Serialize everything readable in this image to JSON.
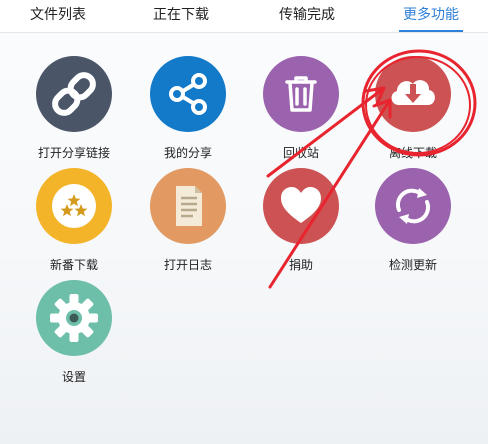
{
  "tabs": [
    {
      "label": "文件列表"
    },
    {
      "label": "正在下载"
    },
    {
      "label": "传输完成"
    },
    {
      "label": "更多功能"
    }
  ],
  "features": [
    {
      "label": "打开分享链接",
      "icon": "link-icon",
      "color": "#4b5568"
    },
    {
      "label": "我的分享",
      "icon": "share-icon",
      "color": "#1379c9"
    },
    {
      "label": "回收站",
      "icon": "trash-icon",
      "color": "#9b62ae"
    },
    {
      "label": "离线下载",
      "icon": "cloud-download-icon",
      "color": "#cd5253"
    },
    {
      "label": "新番下载",
      "icon": "stars-icon",
      "color": "#f4b42a"
    },
    {
      "label": "打开日志",
      "icon": "document-icon",
      "color": "#e39a62"
    },
    {
      "label": "捐助",
      "icon": "heart-icon",
      "color": "#cd5253"
    },
    {
      "label": "检测更新",
      "icon": "refresh-icon",
      "color": "#9b62ae"
    },
    {
      "label": "设置",
      "icon": "gear-icon",
      "color": "#6dbfa9"
    }
  ],
  "colors": {
    "accent": "#2f80d8",
    "annotation_red": "#e8242e"
  }
}
